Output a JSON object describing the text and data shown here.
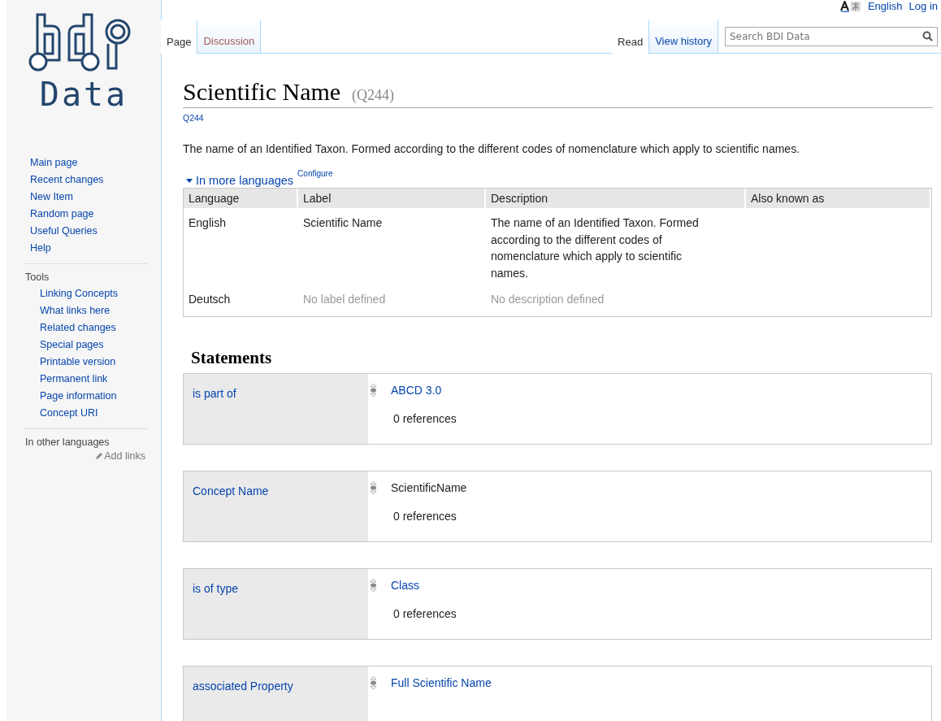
{
  "logo": {
    "wordmark": "Data"
  },
  "personal": {
    "language": "English",
    "login": "Log in"
  },
  "sidebar": {
    "navigation": [
      "Main page",
      "Recent changes",
      "New Item",
      "Random page",
      "Useful Queries",
      "Help"
    ],
    "tools_heading": "Tools",
    "tools": [
      "Linking Concepts",
      "What links here",
      "Related changes",
      "Special pages",
      "Printable version",
      "Permanent link",
      "Page information",
      "Concept URI"
    ],
    "languages_heading": "In other languages",
    "add_links": "Add links"
  },
  "tabs_left": [
    {
      "label": "Page",
      "selected": true
    },
    {
      "label": "Discussion",
      "selected": false
    }
  ],
  "tabs_right": [
    {
      "label": "Read",
      "selected": true
    },
    {
      "label": "View history",
      "selected": false
    }
  ],
  "search": {
    "placeholder": "Search BDI Data"
  },
  "heading": {
    "title": "Scientific Name",
    "id": "(Q244)"
  },
  "id_link": "Q244",
  "description": "The name of an Identified Taxon. Formed according to the different codes of nomenclature which apply to scientific names.",
  "languages": {
    "toggle": "In more languages",
    "expanded": true,
    "configure": "Configure",
    "columns": [
      "Language",
      "Label",
      "Description",
      "Also known as"
    ],
    "rows": [
      {
        "language": "English",
        "label": "Scientific Name",
        "label_missing": false,
        "description": "The name of an Identified Taxon. Formed according to the different codes of nomenclature which apply to scientific names.",
        "description_missing": false
      },
      {
        "language": "Deutsch",
        "label": "No label defined",
        "label_missing": true,
        "description": "No description defined",
        "description_missing": true
      }
    ]
  },
  "statements_heading": "Statements",
  "statements": [
    {
      "property": "is part of",
      "value": "ABCD 3.0",
      "kind": "link",
      "references": "0 references"
    },
    {
      "property": "Concept Name",
      "value": "ScientificName",
      "kind": "text",
      "references": "0 references"
    },
    {
      "property": "is of type",
      "value": "Class",
      "kind": "link",
      "references": "0 references"
    },
    {
      "property": "associated Property",
      "value": "Full Scientific Name",
      "kind": "link"
    }
  ]
}
